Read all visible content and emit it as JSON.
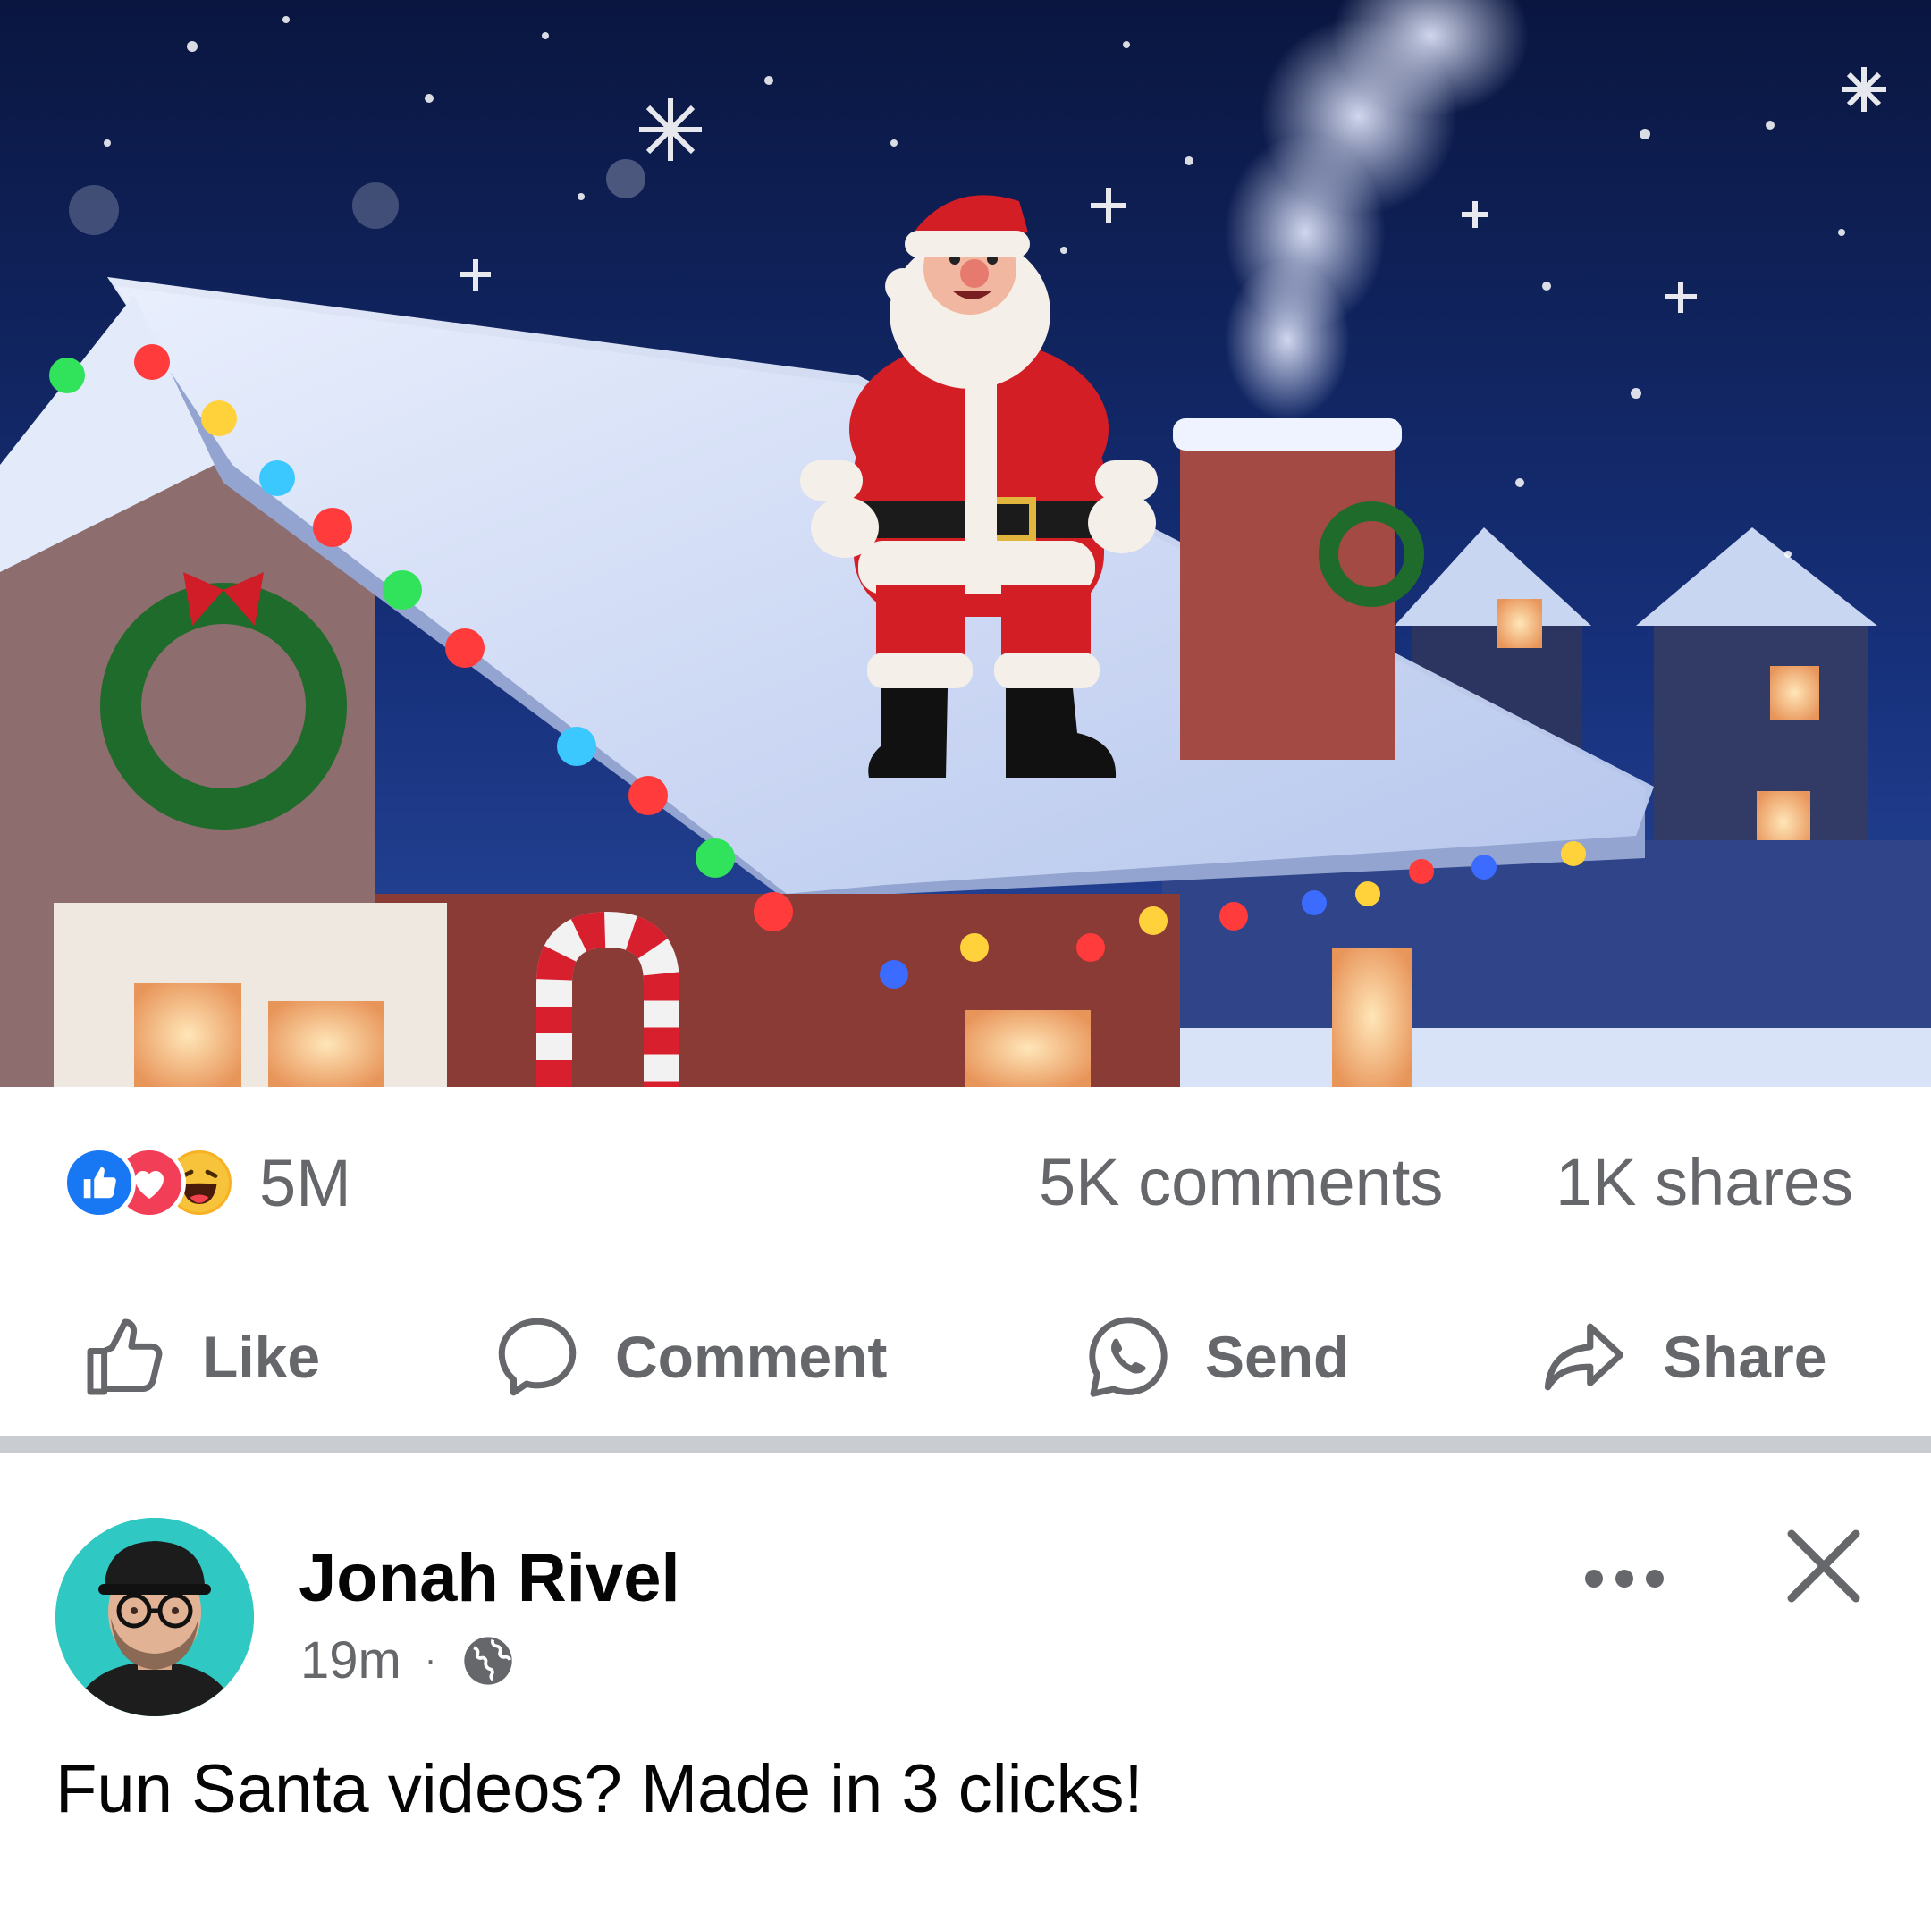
{
  "media": {
    "alt_icon": "santa-on-rooftop-image"
  },
  "stats": {
    "reactions": [
      "like-icon",
      "love-icon",
      "haha-icon"
    ],
    "reaction_count": "5M",
    "comments": "5K comments",
    "shares": "1K shares"
  },
  "actions": {
    "like": "Like",
    "comment": "Comment",
    "send": "Send",
    "share": "Share"
  },
  "next_post": {
    "author": "Jonah Rivel",
    "time": "19m",
    "separator": "·",
    "privacy_icon": "globe-icon",
    "caption": "Fun Santa videos? Made in 3 clicks!"
  },
  "colors": {
    "like_blue": "#1877f2",
    "love_red": "#f33e58",
    "haha_yellow": "#f7b125",
    "secondary_text": "#65676b",
    "avatar_bg": "#2fc8c3"
  }
}
